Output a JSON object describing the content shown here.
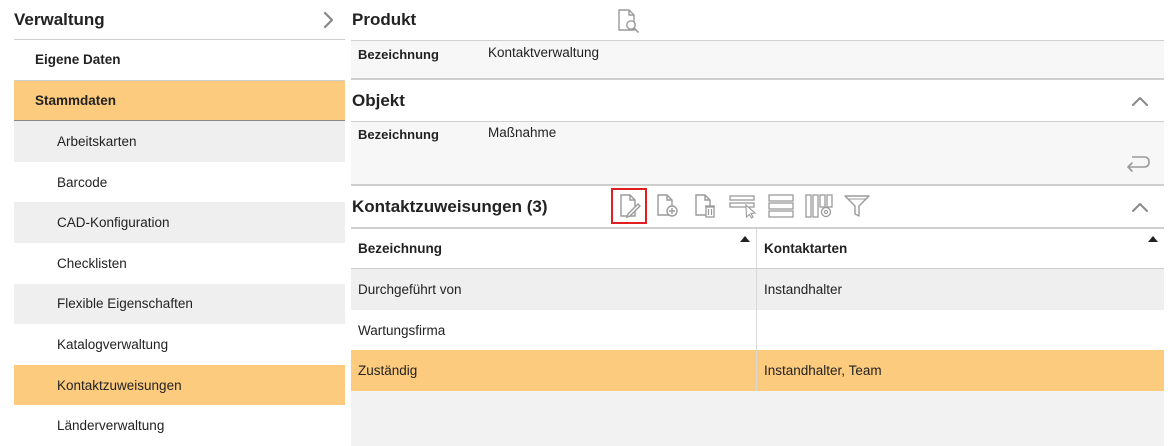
{
  "sidebar": {
    "title": "Verwaltung",
    "items": [
      {
        "label": "Eigene Daten",
        "level": 1,
        "state": "normal"
      },
      {
        "label": "Stammdaten",
        "level": 1,
        "state": "active"
      },
      {
        "label": "Arbeitskarten",
        "level": 2,
        "state": "alt"
      },
      {
        "label": "Barcode",
        "level": 2,
        "state": "normal"
      },
      {
        "label": "CAD-Konfiguration",
        "level": 2,
        "state": "alt"
      },
      {
        "label": "Checklisten",
        "level": 2,
        "state": "normal"
      },
      {
        "label": "Flexible Eigenschaften",
        "level": 2,
        "state": "alt"
      },
      {
        "label": "Katalogverwaltung",
        "level": 2,
        "state": "normal"
      },
      {
        "label": "Kontaktzuweisungen",
        "level": 2,
        "state": "active"
      },
      {
        "label": "Länderverwaltung",
        "level": 2,
        "state": "normal"
      }
    ]
  },
  "produkt": {
    "title": "Produkt",
    "field_label": "Bezeichnung",
    "field_value": "Kontaktverwaltung"
  },
  "objekt": {
    "title": "Objekt",
    "field_label": "Bezeichnung",
    "field_value": "Maßnahme"
  },
  "kontakt": {
    "title": "Kontaktzuweisungen (3)",
    "toolbar": [
      "edit-document-icon",
      "add-document-icon",
      "delete-document-icon",
      "select-rows-icon",
      "row-layout-icon",
      "column-settings-icon",
      "filter-icon"
    ],
    "columns": [
      "Bezeichnung",
      "Kontaktarten"
    ],
    "rows": [
      {
        "bezeichnung": "Durchgeführt von",
        "kontaktarten": "Instandhalter",
        "state": "alt"
      },
      {
        "bezeichnung": "Wartungsfirma",
        "kontaktarten": "",
        "state": "plain"
      },
      {
        "bezeichnung": "Zuständig",
        "kontaktarten": "Instandhalter, Team",
        "state": "active"
      }
    ]
  },
  "colors": {
    "accent": "#fdcb7d",
    "selected_border": "#e02020",
    "alt_row": "#efefef",
    "icon": "#9a9a9a"
  }
}
